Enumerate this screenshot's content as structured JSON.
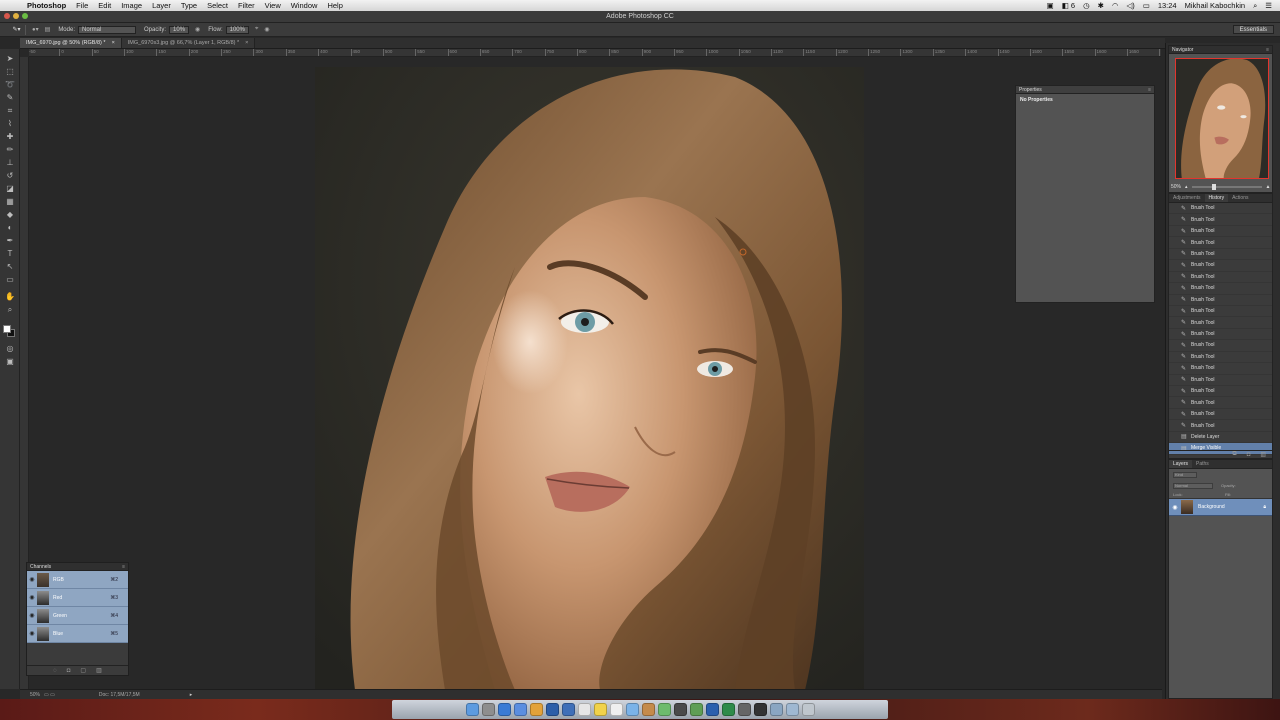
{
  "menubar": {
    "apple_icon": "",
    "app_name": "Photoshop",
    "items": [
      "File",
      "Edit",
      "Image",
      "Layer",
      "Type",
      "Select",
      "Filter",
      "View",
      "Window",
      "Help"
    ],
    "status_badge": "6",
    "clock": "13:24",
    "user": "Mikhail Kabochkin"
  },
  "window": {
    "title": "Adobe Photoshop CC"
  },
  "options": {
    "mode_label": "Mode:",
    "mode_value": "Normal",
    "opacity_label": "Opacity:",
    "opacity_value": "10%",
    "flow_label": "Flow:",
    "flow_value": "100%",
    "workspace": "Essentials"
  },
  "tabs": [
    {
      "label": "IMG_6970.jpg @ 50% (RGB/8) *",
      "close": "×"
    },
    {
      "label": "IMG_6970s3.jpg @ 66,7% (Layer 1, RGB/8) *",
      "close": "×"
    }
  ],
  "ruler_ticks": [
    "-50",
    "0",
    "50",
    "100",
    "150",
    "200",
    "250",
    "300",
    "350",
    "400",
    "450",
    "500",
    "550",
    "600",
    "650",
    "700",
    "750",
    "800",
    "850",
    "900",
    "950",
    "1000",
    "1050",
    "1100",
    "1150",
    "1200",
    "1250",
    "1300",
    "1350",
    "1400",
    "1450",
    "1500",
    "1550",
    "1600",
    "1650",
    "1700",
    "1750",
    "1800"
  ],
  "status": {
    "zoom": "50%",
    "doc": "Doc: 17,5M/17,5M",
    "arrow": "▸"
  },
  "channels": {
    "title": "Channels",
    "rows": [
      {
        "name": "RGB",
        "shortcut": "⌘2"
      },
      {
        "name": "Red",
        "shortcut": "⌘3"
      },
      {
        "name": "Green",
        "shortcut": "⌘4"
      },
      {
        "name": "Blue",
        "shortcut": "⌘5"
      }
    ]
  },
  "properties": {
    "title": "Properties",
    "content": "No Properties"
  },
  "navigator": {
    "title": "Navigator",
    "zoom": "50%"
  },
  "history": {
    "tabs": [
      "Adjustments",
      "History",
      "Actions"
    ],
    "rows": [
      "Brush Tool",
      "Brush Tool",
      "Brush Tool",
      "Brush Tool",
      "Brush Tool",
      "Brush Tool",
      "Brush Tool",
      "Brush Tool",
      "Brush Tool",
      "Brush Tool",
      "Brush Tool",
      "Brush Tool",
      "Brush Tool",
      "Brush Tool",
      "Brush Tool",
      "Brush Tool",
      "Brush Tool",
      "Brush Tool",
      "Brush Tool",
      "Brush Tool",
      "Delete Layer",
      "Merge Visible"
    ]
  },
  "layers": {
    "tabs": [
      "Layers",
      "Paths"
    ],
    "kind_label": "Kind",
    "blend": "Normal",
    "opacity_label": "Opacity:",
    "lock_label": "Lock:",
    "fill_label": "Fill:",
    "layer_name": "Background"
  },
  "dock": [
    "Finder",
    "Launchpad",
    "Safari",
    "Mail",
    "Chrome",
    "Photoshop",
    "Lightroom",
    "Calendar",
    "Notes",
    "Reminders",
    "Preview",
    "Contacts",
    "Maps",
    "Camera",
    "Utility",
    "Word",
    "Excel",
    "Code",
    "Terminal",
    "Documents",
    "Downloads",
    "Trash"
  ]
}
